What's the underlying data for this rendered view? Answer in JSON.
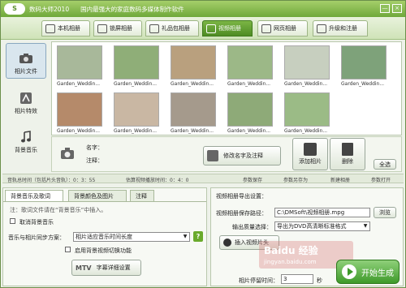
{
  "window": {
    "logo": "S",
    "title": "数码大师2010",
    "subtitle": "国内最强大的家庭数码多媒体制作软件",
    "min": "—",
    "close": "×"
  },
  "tabs": [
    {
      "label": "本机相册",
      "icon": "album-icon"
    },
    {
      "label": "锁屏相册",
      "icon": "screen-icon"
    },
    {
      "label": "礼品包相册",
      "icon": "gift-icon"
    },
    {
      "label": "视频相册",
      "icon": "video-icon",
      "active": true
    },
    {
      "label": "网页相册",
      "icon": "web-icon"
    },
    {
      "label": "升级和注册",
      "icon": "upgrade-icon"
    }
  ],
  "sidebar": {
    "items": [
      {
        "label": "相片文件",
        "icon": "camera-icon",
        "active": true
      },
      {
        "label": "相片特效",
        "icon": "effects-icon"
      },
      {
        "label": "背景音乐",
        "icon": "music-note-icon"
      }
    ]
  },
  "gallery": {
    "photos": [
      {
        "caption": "Garden_Weddin...",
        "color": "#a8b89a"
      },
      {
        "caption": "Garden_Weddin...",
        "color": "#8fae78"
      },
      {
        "caption": "Garden_Weddin...",
        "color": "#b9a07e"
      },
      {
        "caption": "Garden_Weddin...",
        "color": "#9cb887"
      },
      {
        "caption": "Garden_Weddin...",
        "color": "#c7cfbf"
      },
      {
        "caption": "Garden_Weddin...",
        "color": "#7ea27a"
      },
      {
        "caption": "Garden_Weddin...",
        "color": "#b58a6a"
      },
      {
        "caption": "Garden_Weddin...",
        "color": "#c9b7a3"
      },
      {
        "caption": "Garden_Weddin...",
        "color": "#a59a8c"
      },
      {
        "caption": "Garden_Weddin...",
        "color": "#8eaa78"
      },
      {
        "caption": "Garden_Weddin...",
        "color": "#9bbb86"
      }
    ]
  },
  "info": {
    "name_label": "名字：",
    "note_label": "注释：",
    "edit_button": "修改名字及注释",
    "add_button": "添加相片",
    "delete_button": "删除",
    "select_all": "全选"
  },
  "status": {
    "music_time": "音轨总时间（包括片头音轨）：0：3：55",
    "video_time": "估算视频播放时间：0：4：0",
    "save_params": "参数保存",
    "save_as": "参数另存为",
    "new_album": "新建相册",
    "open_params": "参数打开"
  },
  "left_panel": {
    "tabs": [
      "背景音乐及歌词",
      "背景颜色及图片",
      "注释"
    ],
    "note": "注：歌词文件请在“背景音乐”中插入。",
    "cancel_music": "取消背景音乐",
    "sync_label": "音乐与相片同步方案：",
    "sync_value": "相片适应音乐时间长度",
    "help": "?",
    "enable_switch": "启用背景视频切换功能",
    "subtitle_button": "字幕详细设置",
    "mtv": "MTV"
  },
  "right_panel": {
    "heading": "视频相册导出设置：",
    "path_label": "视频相册保存路径：",
    "path_value": "C:\\DMSoft\\视频相册.mpg",
    "browse": "浏览",
    "quality_label": "输出质量选择：",
    "quality_value": "导出为DVD高清晰标准格式",
    "insert_button": "插入视频片头",
    "stay_label": "相片停留时间：",
    "stay_value": "3",
    "stay_unit": "秒",
    "watermark_line1": "Baidu 经验",
    "watermark_line2": "jingyan.baidu.com",
    "start_button": "开始生成"
  }
}
